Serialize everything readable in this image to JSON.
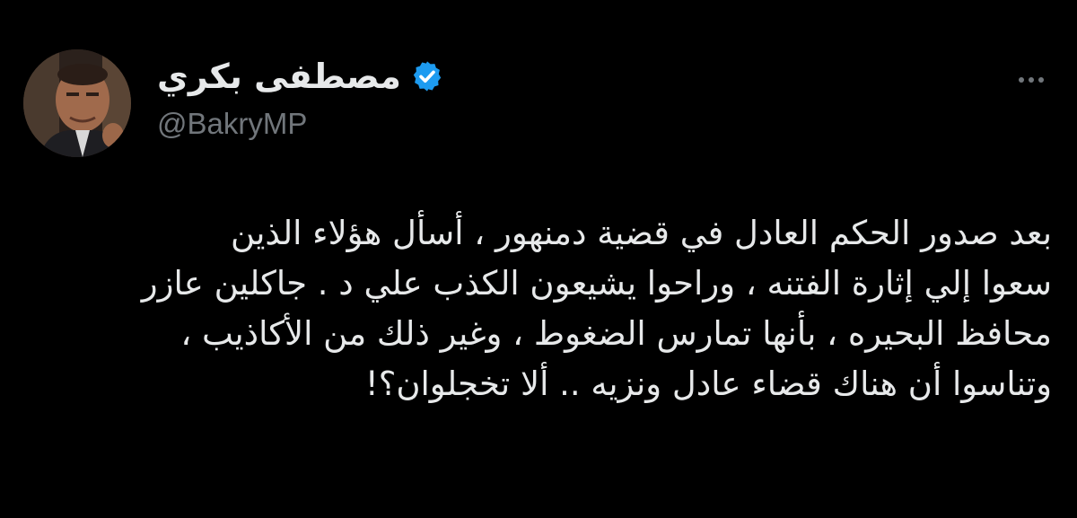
{
  "tweet": {
    "author": {
      "display_name": "مصطفى بكري",
      "handle": "@BakryMP",
      "verified": true,
      "verified_color": "#1d9bf0"
    },
    "more_icon": "more-horizontal-icon",
    "text_lines": [
      "بعد صدور الحكم العادل في قضية دمنهور ، أسأل هؤلاء الذين",
      "سعوا إلي إثارة الفتنه ، وراحوا يشيعون الكذب علي د . جاكلين عازر",
      "محافظ البحيره ، بأنها تمارس الضغوط ، وغير ذلك من الأكاذيب ،",
      "وتناسوا أن هناك قضاء عادل ونزيه .. ألا تخجلوان؟!"
    ]
  },
  "theme": {
    "background": "#000000",
    "text": "#e7e9ea",
    "secondary_text": "#71767b",
    "accent": "#1d9bf0"
  }
}
